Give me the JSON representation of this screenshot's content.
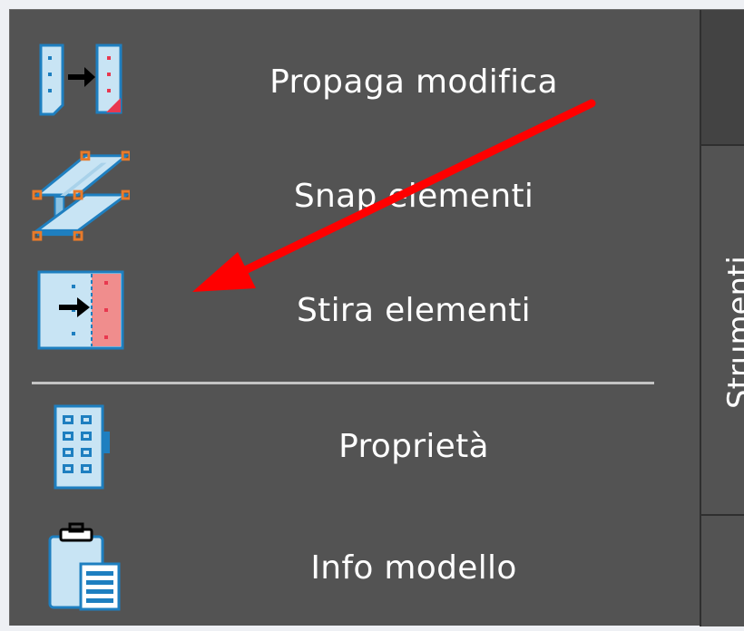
{
  "menu": {
    "items": [
      {
        "label": "Propaga modifica",
        "icon": "propagate-change-icon"
      },
      {
        "label": "Snap elementi",
        "icon": "snap-elements-icon"
      },
      {
        "label": "Stira elementi",
        "icon": "stretch-elements-icon"
      },
      {
        "label": "Proprietà",
        "icon": "properties-icon"
      },
      {
        "label": "Info modello",
        "icon": "model-info-icon"
      }
    ]
  },
  "side_tab": {
    "label": "Strumenti"
  },
  "annotation": {
    "type": "arrow",
    "color": "#ff0000"
  },
  "colors": {
    "panel_background": "#535353",
    "icon_light_blue": "#c8e4f4",
    "icon_blue_border": "#1e7fc0",
    "icon_red": "#e8384f",
    "icon_orange": "#e87a2a"
  }
}
